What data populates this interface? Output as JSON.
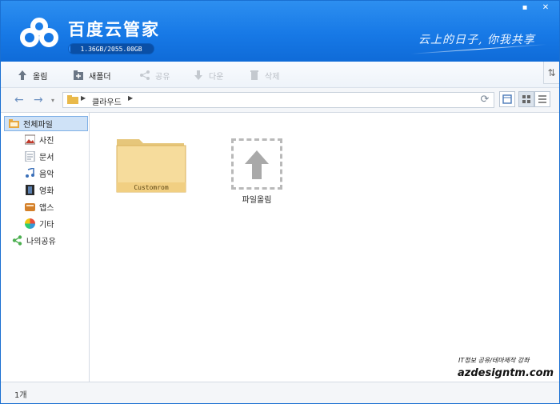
{
  "app": {
    "title": "百度云管家",
    "storage_text": "1.36GB/2055.00GB",
    "storage_used_fraction": 0.0007,
    "slogan": "云上的日子, 你我共享"
  },
  "window_controls": {
    "minimize": "▪",
    "close": "✕"
  },
  "toolbar": {
    "upload_label": "올림",
    "new_folder_label": "새폴더",
    "share_label": "공유",
    "download_label": "다운",
    "delete_label": "삭제"
  },
  "address": {
    "breadcrumb": "클라우드"
  },
  "sidebar": {
    "items": [
      {
        "label": "전체파일",
        "icon": "folder-icon"
      },
      {
        "label": "사진",
        "icon": "photo-icon"
      },
      {
        "label": "문서",
        "icon": "document-icon"
      },
      {
        "label": "음악",
        "icon": "music-icon"
      },
      {
        "label": "영화",
        "icon": "film-icon"
      },
      {
        "label": "앱스",
        "icon": "apps-icon"
      },
      {
        "label": "기타",
        "icon": "pie-icon"
      },
      {
        "label": "나의공유",
        "icon": "share-icon"
      }
    ]
  },
  "main": {
    "folder_name": "Customrom",
    "upload_label": "파일올림",
    "watermark_small": "IT정보 공유/테마제작 강좌",
    "watermark_big": "azdesigntm.com"
  },
  "status": {
    "count": "1개"
  },
  "colors": {
    "header_blue": "#1779e6",
    "accent": "#2a8cff"
  }
}
